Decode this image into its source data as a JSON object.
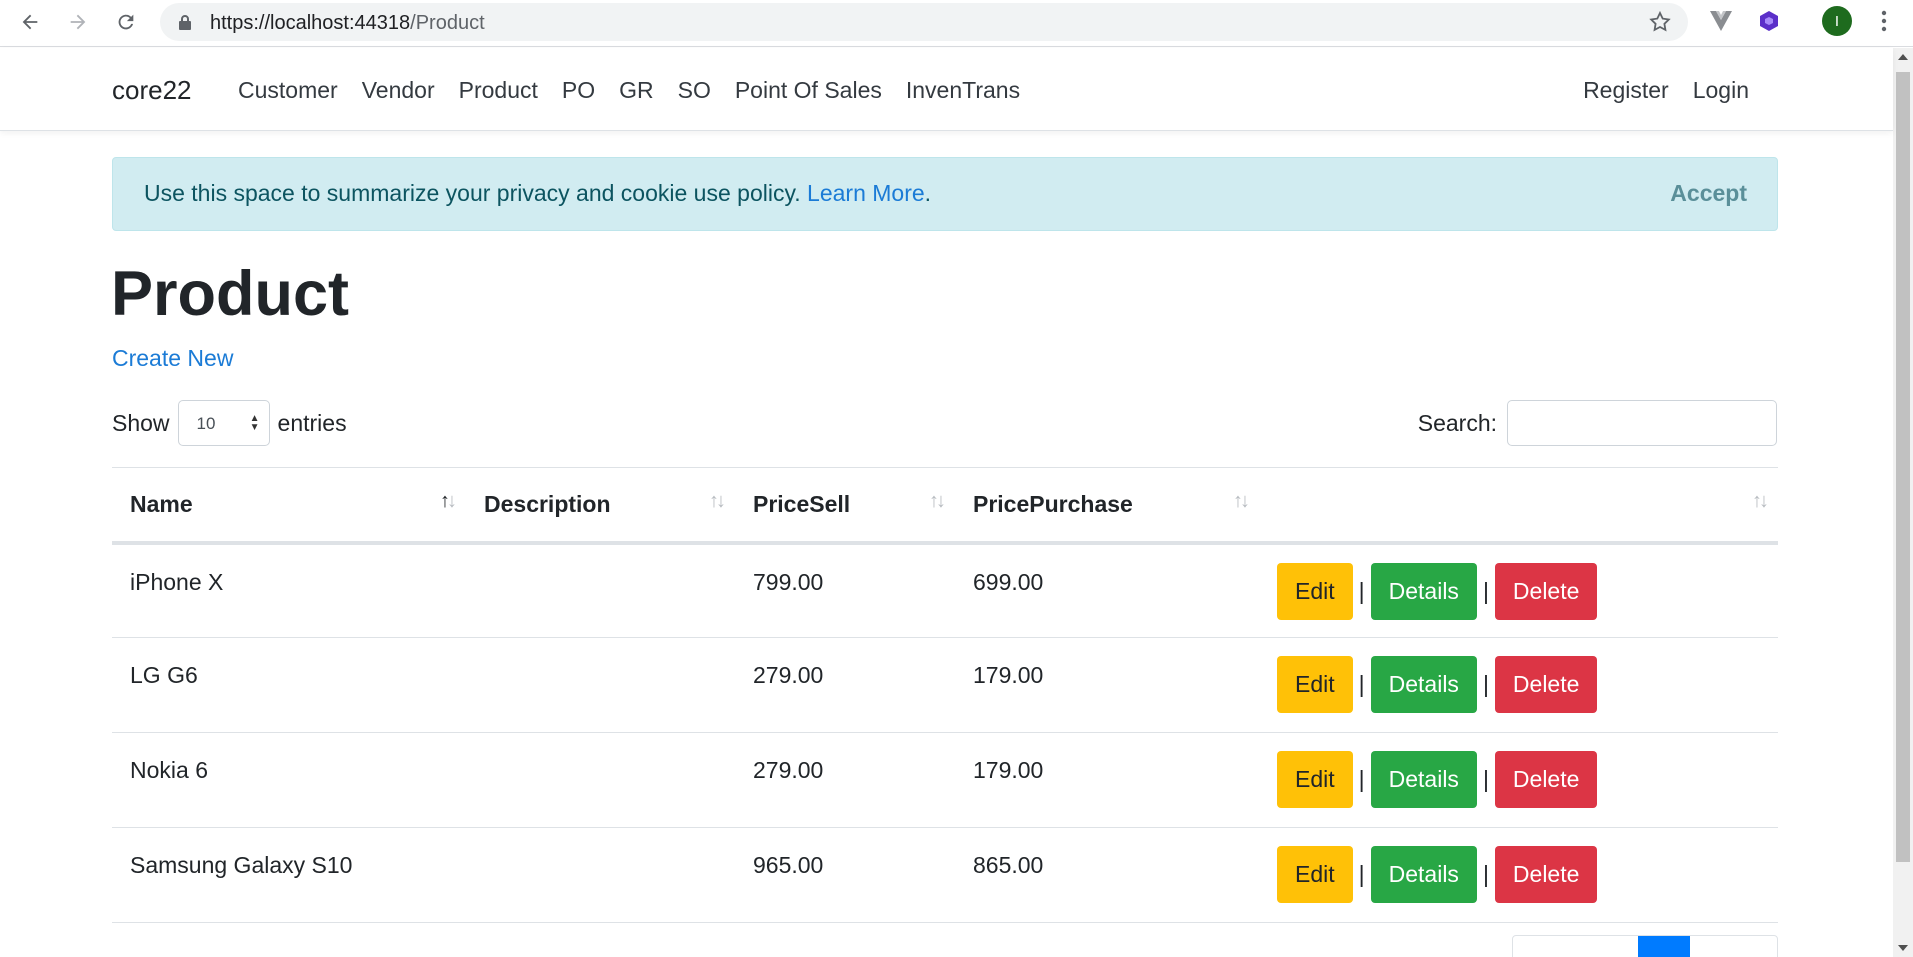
{
  "browser": {
    "url_host": "https://localhost:",
    "url_host_port": "44318",
    "url_path": "/Product",
    "avatar_letter": "I"
  },
  "navbar": {
    "brand": "core22",
    "links": [
      "Customer",
      "Vendor",
      "Product",
      "PO",
      "GR",
      "SO",
      "Point Of Sales",
      "InvenTrans"
    ],
    "right_links": [
      "Register",
      "Login"
    ]
  },
  "cookie": {
    "message": "Use this space to summarize your privacy and cookie use policy.",
    "learn_more": "Learn More",
    "period": ".",
    "accept": "Accept"
  },
  "page": {
    "title": "Product",
    "create_new": "Create New"
  },
  "table_controls": {
    "show_label": "Show",
    "entries_value": "10",
    "entries_label": "entries",
    "search_label": "Search:"
  },
  "table": {
    "headers": [
      "Name",
      "Description",
      "PriceSell",
      "PricePurchase",
      ""
    ],
    "rows": [
      {
        "name": "iPhone X",
        "description": "",
        "price_sell": "799.00",
        "price_purchase": "699.00"
      },
      {
        "name": "LG G6",
        "description": "",
        "price_sell": "279.00",
        "price_purchase": "179.00"
      },
      {
        "name": "Nokia 6",
        "description": "",
        "price_sell": "279.00",
        "price_purchase": "179.00"
      },
      {
        "name": "Samsung Galaxy S10",
        "description": "",
        "price_sell": "965.00",
        "price_purchase": "865.00"
      }
    ],
    "actions": {
      "edit": "Edit",
      "details": "Details",
      "delete": "Delete",
      "separator": "|"
    }
  },
  "colors": {
    "accent": "#007bff",
    "edit": "#ffc107",
    "details": "#28a745",
    "delete": "#dc3545",
    "alert_bg": "#d1ecf1"
  }
}
